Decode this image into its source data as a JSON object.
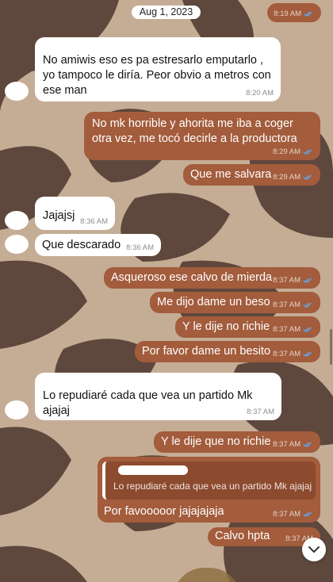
{
  "chat": {
    "date_label": "Aug 1, 2023",
    "top_time": "8:19 AM",
    "messages": [
      {
        "dir": "in",
        "text": "No amiwis eso es pa estresarlo emputarlo , yo tampoco le diría. Peor obvio a metros con ese man",
        "time": "8:20 AM"
      },
      {
        "dir": "out",
        "text": "No mk horrible y ahorita me iba a coger otra vez, me tocó decirle a la productora",
        "time": "8:29 AM"
      },
      {
        "dir": "out",
        "text": "Que me salvara",
        "time": "8:29 AM"
      },
      {
        "dir": "in",
        "text": "Jajajsj",
        "time": "8:36 AM"
      },
      {
        "dir": "in",
        "text": "Que descarado",
        "time": "8:36 AM"
      },
      {
        "dir": "out",
        "text": "Asqueroso ese calvo de mierda",
        "time": "8:37 AM"
      },
      {
        "dir": "out",
        "text": "Me dijo dame un beso",
        "time": "8:37 AM"
      },
      {
        "dir": "out",
        "text": "Y le dije no richie",
        "time": "8:37 AM"
      },
      {
        "dir": "out",
        "text": "Por favor dame un besito",
        "time": "8:37 AM"
      },
      {
        "dir": "in",
        "text": "Lo repudiaré cada que vea un partido Mk ajajaj",
        "time": "8:37 AM"
      },
      {
        "dir": "out",
        "text": "Y le dije que no richie",
        "time": "8:37 AM"
      },
      {
        "dir": "out",
        "text": "Por favooooor jajajajaja",
        "time": "8:37 AM",
        "quote": "Lo repudiaré cada que vea un partido Mk ajajaj"
      },
      {
        "dir": "out",
        "text": "Calvo hpta",
        "time": "8:37 AM"
      }
    ]
  },
  "colors": {
    "incoming_bubble": "#ffffff",
    "outgoing_bubble": "#a35c3c",
    "read_ticks": "#5ab1ff",
    "wallpaper_base": "#c5ad95",
    "wallpaper_leaves": "#5e473c"
  },
  "icons": {
    "read_receipt": "double-check-icon",
    "scroll_down": "chevron-down-icon"
  }
}
